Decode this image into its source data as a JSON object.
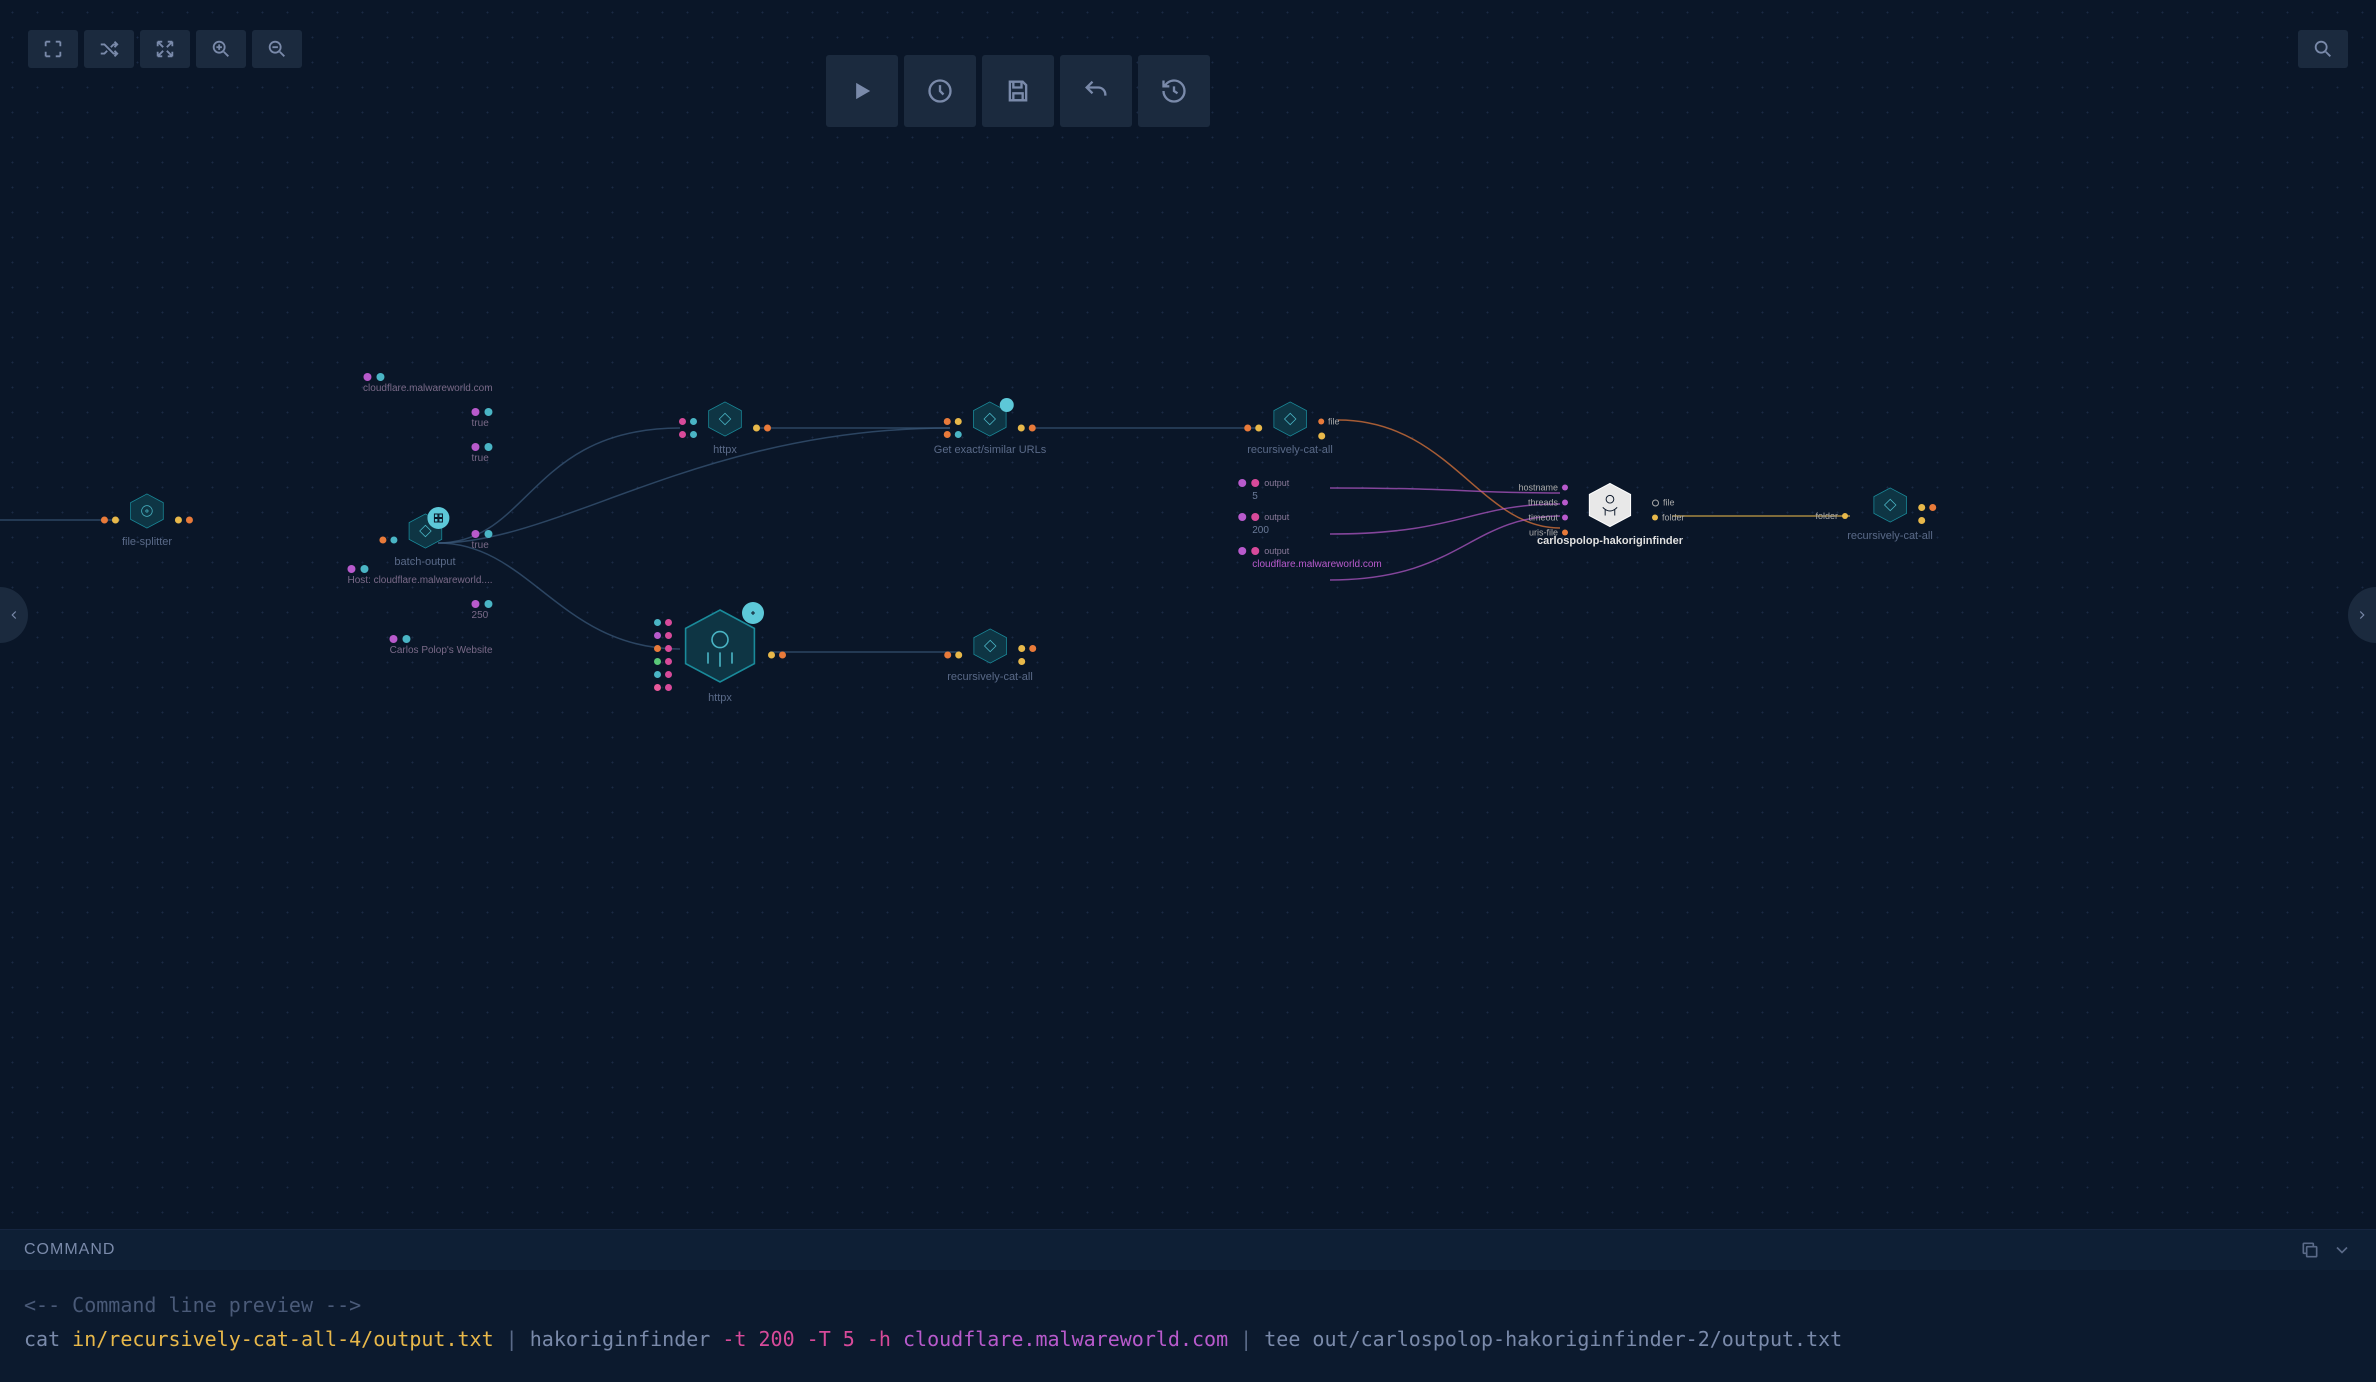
{
  "command": {
    "title": "COMMAND",
    "comment": "<-- Command line preview -->",
    "tokens": {
      "cat": "cat ",
      "path": "in/recursively-cat-all-4/output.txt",
      "pipe1": " | ",
      "cmd1": "hakoriginfinder ",
      "flags": "-t 200 -T 5 -h ",
      "host": "cloudflare.malwareworld.com",
      "pipe2": " | ",
      "tee": "tee out/carlospolop-hakoriginfinder-2/output.txt"
    }
  },
  "chips": {
    "c1": "cloudflare.malwareworld.com",
    "c2": "true",
    "c3": "true",
    "c4": "true",
    "c5": "Host: cloudflare.malwareworld....",
    "c6": "250",
    "c7": "Carlos Polop's Website"
  },
  "nodes": {
    "file_splitter": "file-splitter",
    "batch_output": "batch-output",
    "httpx1": "httpx",
    "httpx2": "httpx",
    "get_urls": "Get exact/similar URLs",
    "recursively1": "recursively-cat-all",
    "recursively2": "recursively-cat-all",
    "recursively3": "recursively-cat-all",
    "hakorigin": "carlospolop-hakoriginfinder"
  },
  "params": {
    "p1_label": "output",
    "p1_val": "5",
    "p2_label": "output",
    "p2_val": "200",
    "p3_label": "output",
    "p3_url": "cloudflare.malwareworld.com",
    "p_file": "file"
  },
  "hak_in": {
    "hostname": "hostname",
    "threads": "threads",
    "timeout": "timeout",
    "uris_file": "uris-file"
  },
  "hak_out": {
    "file": "file",
    "folder": "folder"
  },
  "out_label": "folder"
}
